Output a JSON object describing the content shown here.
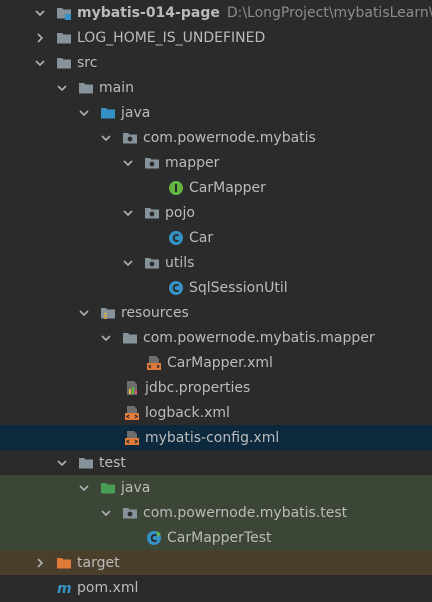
{
  "project_tree": {
    "root": {
      "label": "mybatis-014-page",
      "path": "D:\\LongProject\\mybatisLearn\\myba"
    },
    "log_home": {
      "label": "LOG_HOME_IS_UNDEFINED"
    },
    "src": {
      "label": "src"
    },
    "main": {
      "label": "main"
    },
    "java": {
      "label": "java"
    },
    "pkg_main": {
      "label": "com.powernode.mybatis"
    },
    "mapper": {
      "label": "mapper"
    },
    "car_mapper": {
      "label": "CarMapper"
    },
    "pojo": {
      "label": "pojo"
    },
    "car": {
      "label": "Car"
    },
    "utils": {
      "label": "utils"
    },
    "sql_session_util": {
      "label": "SqlSessionUtil"
    },
    "resources": {
      "label": "resources"
    },
    "res_pkg": {
      "label": "com.powernode.mybatis.mapper"
    },
    "car_mapper_xml": {
      "label": "CarMapper.xml"
    },
    "jdbc_properties": {
      "label": "jdbc.properties"
    },
    "logback_xml": {
      "label": "logback.xml"
    },
    "mybatis_config_xml": {
      "label": "mybatis-config.xml"
    },
    "test": {
      "label": "test"
    },
    "test_java": {
      "label": "java"
    },
    "test_pkg": {
      "label": "com.powernode.mybatis.test"
    },
    "car_mapper_test": {
      "label": "CarMapperTest"
    },
    "target": {
      "label": "target"
    },
    "pom_xml": {
      "label": "pom.xml"
    }
  },
  "icons": {
    "folder": "folder-icon",
    "source_folder": "source-folder-icon",
    "test_folder": "test-source-folder-icon",
    "resources_folder": "resources-folder-icon",
    "excluded_folder": "excluded-folder-icon",
    "package": "package-icon",
    "interface": "interface-icon",
    "class": "class-icon",
    "xml": "xml-file-icon",
    "properties": "properties-file-icon",
    "maven": "maven-pom-icon"
  },
  "colors": {
    "background": "#2b2b2b",
    "selection": "#0d293e",
    "test_band": "#3c4636",
    "excluded_band": "#4a3f2b",
    "folder": "#87939a",
    "source_folder": "#3592c4",
    "test_folder": "#499c54",
    "excluded_folder": "#e07b3a",
    "interface": "#62b543",
    "class": "#3592c4",
    "xml": "#e07b3a"
  }
}
